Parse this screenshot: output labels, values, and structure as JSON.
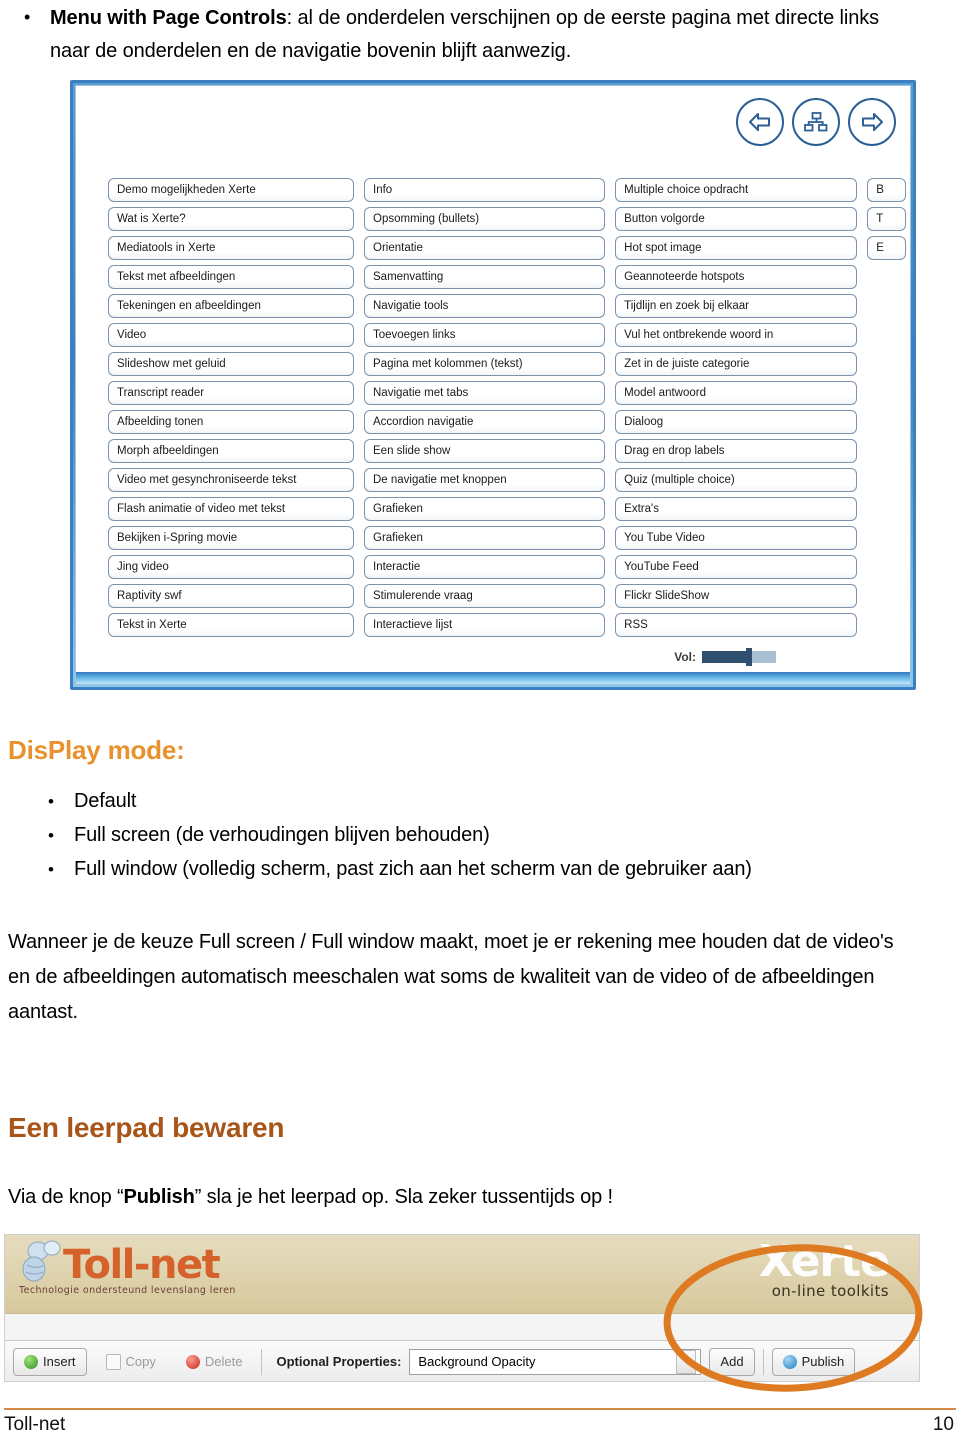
{
  "intro": {
    "bullet_char": "•",
    "lead": "Menu with Page Controls",
    "rest": ": al de onderdelen verschijnen op de eerste pagina met directe links naar de onderdelen en de navigatie bovenin blijft aanwezig."
  },
  "player": {
    "nav_icons": [
      "back-arrow-icon",
      "menu-grid-icon",
      "forward-arrow-icon"
    ],
    "volume_label": "Vol:",
    "volume_percent": 62,
    "columns": [
      {
        "items": [
          "Demo mogelijkheden Xerte",
          "Wat is Xerte?",
          "Mediatools in Xerte",
          "Tekst  met afbeeldingen",
          "Tekeningen en afbeeldingen",
          "Video",
          "Slideshow met geluid",
          "Transcript reader",
          "Afbeelding tonen",
          "Morph afbeeldingen",
          "Video met gesynchroniseerde tekst",
          "Flash animatie of video met tekst",
          "Bekijken i-Spring movie",
          "Jing video",
          "Raptivity swf",
          "Tekst in Xerte"
        ]
      },
      {
        "items": [
          "Info",
          "Opsomming (bullets)",
          "Orientatie",
          "Samenvatting",
          "Navigatie tools",
          "Toevoegen links",
          "Pagina met kolommen (tekst)",
          "Navigatie met tabs",
          "Accordion navigatie",
          "Een slide show",
          "De navigatie met knoppen",
          "Grafieken",
          "Grafieken",
          "Interactie",
          "Stimulerende vraag",
          "Interactieve lijst"
        ]
      },
      {
        "items": [
          "Multiple choice opdracht",
          "Button volgorde",
          "Hot spot image",
          "Geannoteerde hotspots",
          "Tijdlijn en zoek bij elkaar",
          "Vul het ontbrekende woord in",
          "Zet in de juiste categorie",
          "Model antwoord",
          "Dialoog",
          "Drag en drop labels",
          "Quiz (multiple choice)",
          "Extra's",
          "You Tube Video",
          "YouTube Feed",
          "Flickr SlideShow",
          "RSS"
        ]
      },
      {
        "items": [
          "B",
          "T",
          "E"
        ]
      }
    ]
  },
  "display_mode": {
    "heading": "DisPlay mode:",
    "bullet_char": "•",
    "items": [
      "Default",
      "Full screen (de verhoudingen blijven behouden)",
      "Full window (volledig scherm, past zich aan het scherm van de gebruiker aan)"
    ]
  },
  "note_paragraph": "Wanneer je de keuze Full screen / Full window maakt, moet je er rekening mee houden dat de video's en de afbeeldingen automatisch meeschalen wat soms de kwaliteit van de video of de afbeeldingen aantast.",
  "save_section": {
    "heading": "Een leerpad bewaren",
    "text_before": "Via de knop “",
    "bold_word": "Publish",
    "text_after": "” sla je het leerpad op.  Sla zeker tussentijds op !"
  },
  "editor": {
    "tollnet_name": "Toll-net",
    "tollnet_tagline": "Technologie ondersteund levenslang leren",
    "xerte_name": "Xerte",
    "xerte_tagline": "on-line toolkits",
    "toolbar": {
      "insert": "Insert",
      "copy": "Copy",
      "delete": "Delete",
      "optional_properties_label": "Optional Properties:",
      "selected_property": "Background Opacity",
      "add": "Add",
      "publish": "Publish"
    }
  },
  "footer": {
    "left": "Toll-net",
    "page_number": "10"
  },
  "colors": {
    "orange_heading": "#e8912d",
    "brown_heading": "#a8551a",
    "annotation": "#dd7a22",
    "player_frame": "#3d7fc1",
    "footer_rule": "#d4884a"
  }
}
